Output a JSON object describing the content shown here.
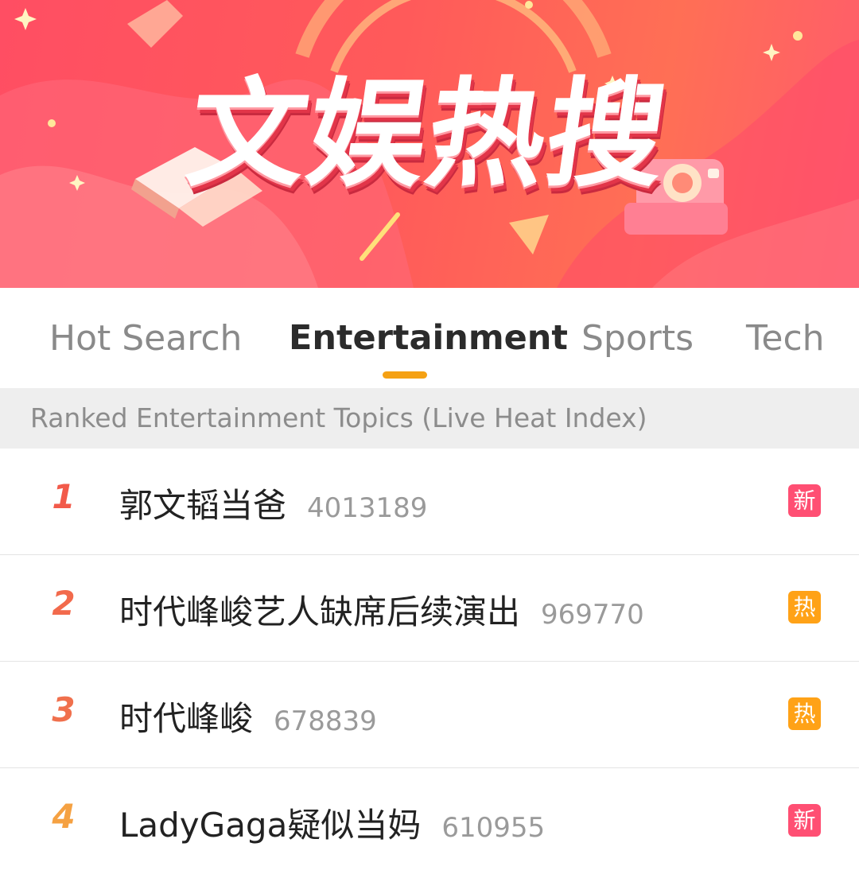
{
  "banner": {
    "title": "文娱热搜"
  },
  "tabs": [
    {
      "label": "Hot Search",
      "active": false
    },
    {
      "label": "Entertainment",
      "active": true
    },
    {
      "label": "Sports",
      "active": false
    },
    {
      "label": "Tech",
      "active": false
    }
  ],
  "section": {
    "header": "Ranked Entertainment Topics (Live Heat Index)"
  },
  "colors": {
    "accent": "#f5a113",
    "badge_new": "#ff4f73",
    "badge_hot": "#ffa217",
    "rank_red": "#f25a4a",
    "rank_orange": "#f5a142"
  },
  "items": [
    {
      "rank": "1",
      "topic": "郭文韬当爸",
      "heat": "4013189",
      "badge": "新",
      "badge_type": "new"
    },
    {
      "rank": "2",
      "topic": "时代峰峻艺人缺席后续演出",
      "heat": "969770",
      "badge": "热",
      "badge_type": "hot"
    },
    {
      "rank": "3",
      "topic": "时代峰峻",
      "heat": "678839",
      "badge": "热",
      "badge_type": "hot"
    },
    {
      "rank": "4",
      "topic": "LadyGaga疑似当妈",
      "heat": "610955",
      "badge": "新",
      "badge_type": "new"
    }
  ]
}
